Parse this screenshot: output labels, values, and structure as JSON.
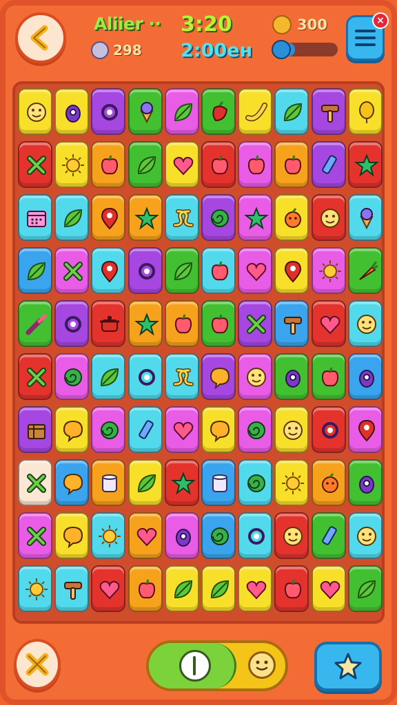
{
  "header": {
    "title": "Aliier ··",
    "time": "3:20",
    "sub_time": "2:00ен",
    "lives": "298",
    "coins": "300",
    "progress_fraction": 0.1,
    "badge": "×"
  },
  "colors": {
    "background": "#f36b35",
    "board": "#cf4d2b",
    "accent_blue": "#37b7ee",
    "accent_green": "#7bd23a",
    "accent_yellow": "#f5c418"
  },
  "grid": {
    "rows": 10,
    "cols": 10,
    "tiles": [
      [
        "yellow",
        "yellow",
        "purple",
        "green",
        "magenta",
        "green",
        "yellow",
        "cyan",
        "purple",
        "yellow"
      ],
      [
        "red",
        "yellow",
        "orange",
        "green",
        "yellow",
        "red",
        "magenta",
        "orange",
        "purple",
        "red"
      ],
      [
        "cyan",
        "cyan",
        "orange",
        "orange",
        "cyan",
        "purple",
        "magenta",
        "yellow",
        "red",
        "cyan"
      ],
      [
        "blue",
        "magenta",
        "cyan",
        "purple",
        "green",
        "cyan",
        "magenta",
        "yellow",
        "magenta",
        "green"
      ],
      [
        "green",
        "purple",
        "red",
        "orange",
        "orange",
        "green",
        "purple",
        "blue",
        "red",
        "cyan"
      ],
      [
        "red",
        "magenta",
        "cyan",
        "cyan",
        "cyan",
        "purple",
        "magenta",
        "green",
        "green",
        "blue"
      ],
      [
        "purple",
        "yellow",
        "magenta",
        "cyan",
        "magenta",
        "yellow",
        "magenta",
        "yellow",
        "red",
        "magenta"
      ],
      [
        "cream",
        "blue",
        "orange",
        "yellow",
        "red",
        "blue",
        "cyan",
        "yellow",
        "orange",
        "green"
      ],
      [
        "magenta",
        "yellow",
        "cyan",
        "orange",
        "magenta",
        "blue",
        "cyan",
        "red",
        "green",
        "cyan"
      ],
      [
        "cyan",
        "cyan",
        "red",
        "orange",
        "yellow",
        "yellow",
        "yellow",
        "red",
        "yellow",
        "green"
      ]
    ],
    "icons": [
      [
        "smiley",
        "bug",
        "ring",
        "icecream",
        "leaf",
        "pepper",
        "banana",
        "leaf",
        "hammer",
        "balloon"
      ],
      [
        "cross",
        "sun",
        "apple",
        "leaf",
        "heart",
        "apple",
        "apple",
        "apple",
        "pen",
        "star"
      ],
      [
        "calendar",
        "leaf",
        "pin",
        "star",
        "knot",
        "swirl",
        "star",
        "fruit",
        "smiley",
        "icecream"
      ],
      [
        "leaf",
        "cross",
        "pin",
        "ring",
        "leaf",
        "apple",
        "heart",
        "pin",
        "sun",
        "carrot"
      ],
      [
        "brush",
        "ring",
        "pot",
        "star",
        "apple",
        "apple",
        "cross",
        "hammer",
        "heart",
        "smiley"
      ],
      [
        "cross",
        "swirl",
        "leaf",
        "ring",
        "knot",
        "bubble",
        "smiley",
        "bug",
        "apple",
        "bug"
      ],
      [
        "box",
        "bubble",
        "swirl",
        "pen",
        "heart",
        "bubble",
        "swirl",
        "smiley",
        "ring",
        "pin"
      ],
      [
        "cross",
        "bubble",
        "cup",
        "leaf",
        "star",
        "cup",
        "swirl",
        "sun",
        "fruit",
        "bug"
      ],
      [
        "cross",
        "bubble",
        "sun",
        "heart",
        "bug",
        "swirl",
        "ring",
        "smiley",
        "pen",
        "smiley"
      ],
      [
        "sun",
        "hammer",
        "heart",
        "apple",
        "leaf",
        "leaf",
        "heart",
        "apple",
        "heart",
        "leaf"
      ]
    ]
  },
  "footer": {
    "left_button_icon": "cross-icon",
    "pill_icon": "pause-icon",
    "pill_face_icon": "face-icon",
    "right_button_icon": "star-icon"
  }
}
